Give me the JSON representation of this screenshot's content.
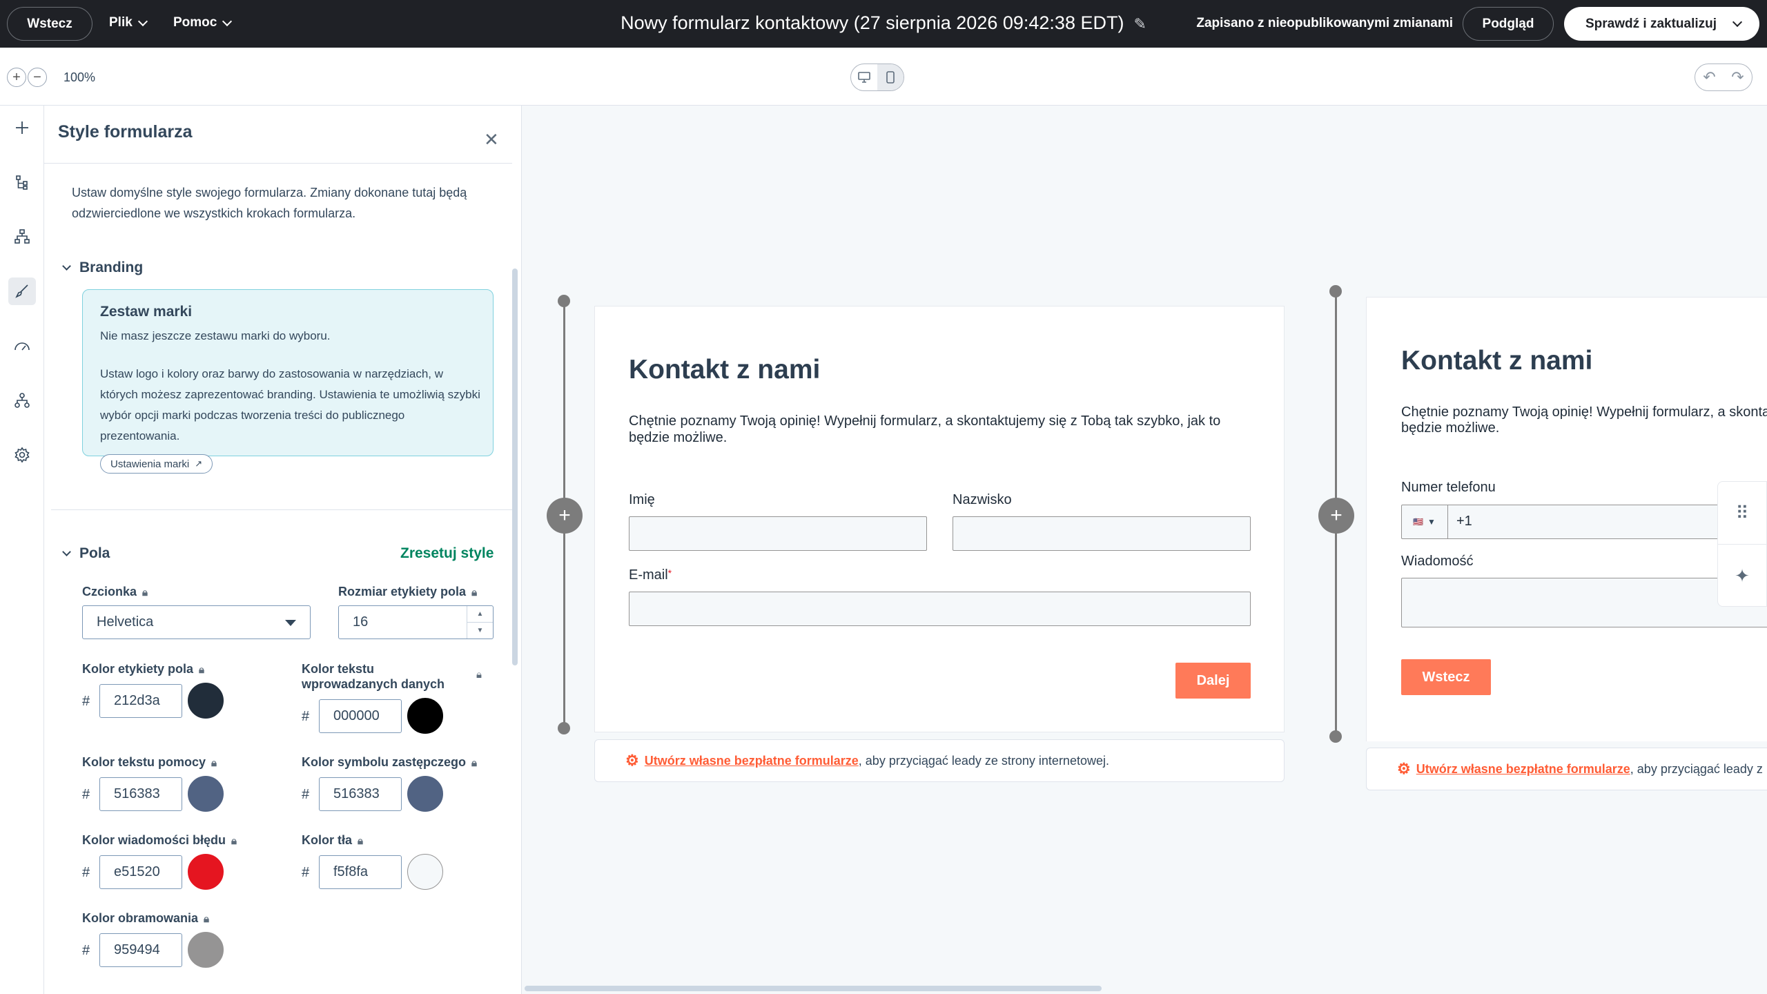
{
  "topbar": {
    "back_label": "Wstecz",
    "file_menu": "Plik",
    "help_menu": "Pomoc",
    "title": "Nowy formularz kontaktowy (27 sierpnia 2026 09:42:38 EDT)",
    "status": "Zapisano z nieopublikowanymi zmianami",
    "preview_label": "Podgląd",
    "publish_label": "Sprawdź i zaktualizuj"
  },
  "toolbar": {
    "zoom": "100%",
    "zoom_in": "+",
    "zoom_out": "−"
  },
  "rail": {
    "icons": [
      "add-icon",
      "tree-icon",
      "hierarchy-icon",
      "brush-icon",
      "gauge-icon",
      "org-chart-icon",
      "gear-icon"
    ]
  },
  "panel": {
    "title": "Style formularza",
    "description": "Ustaw domyślne style swojego formularza. Zmiany dokonane tutaj będą odzwierciedlone we wszystkich krokach formularza.",
    "branding": {
      "heading": "Branding",
      "box_title": "Zestaw marki",
      "box_text1": "Nie masz jeszcze zestawu marki do wyboru.",
      "box_text2": "Ustaw logo i kolory oraz barwy do zastosowania w narzędziach, w których możesz zaprezentować branding. Ustawienia te umożliwią szybki wybór opcji marki podczas tworzenia treści do publicznego prezentowania.",
      "link_label": "Ustawienia marki"
    },
    "fields": {
      "heading": "Pola",
      "reset_label": "Zresetuj style",
      "font_label": "Czcionka",
      "font_value": "Helvetica",
      "label_size_label": "Rozmiar etykiety pola",
      "label_size_value": "16",
      "label_color_label": "Kolor etykiety pola",
      "label_color_value": "212d3a",
      "input_text_color_label_line1": "Kolor tekstu",
      "input_text_color_label_line2": "wprowadzanych danych",
      "input_text_color_value": "000000",
      "help_text_color_label": "Kolor tekstu pomocy",
      "help_text_color_value": "516383",
      "placeholder_color_label": "Kolor symbolu zastępczego",
      "placeholder_color_value": "516383",
      "error_color_label": "Kolor wiadomości błędu",
      "error_color_value": "e51520",
      "background_color_label": "Kolor tła",
      "background_color_value": "f5f8fa",
      "border_color_label": "Kolor obramowania",
      "border_color_value": "959494",
      "hash": "#"
    }
  },
  "form_step1": {
    "title": "Kontakt z nami",
    "description": "Chętnie poznamy Twoją opinię! Wypełnij formularz, a skontaktujemy się z Tobą tak szybko, jak to będzie możliwe.",
    "first_name_label": "Imię",
    "last_name_label": "Nazwisko",
    "email_label": "E-mail",
    "required_mark": "*",
    "next_label": "Dalej"
  },
  "form_step2": {
    "title": "Kontakt z nami",
    "description_line1": "Chętnie poznamy Twoją opinię! Wypełnij formularz, a skonta",
    "description_line2": "będzie możliwe.",
    "phone_label": "Numer telefonu",
    "phone_prefix": "+1",
    "message_label": "Wiadomość",
    "back_label": "Wstecz"
  },
  "footer": {
    "link_text": "Utwórz własne bezpłatne formularze",
    "rest_text": ", aby przyciągać leady ze strony internetowej.",
    "rest_text_cut": ", aby przyciągać leady z"
  },
  "colors": {
    "topbar": "#1f2126",
    "accent": "#ff7a59",
    "link_green": "#00845f",
    "label_color": "#212d3a",
    "input_text_color": "#000000",
    "help_text_color": "#516383",
    "placeholder_color": "#516383",
    "error_color": "#e51520",
    "background_color": "#f5f8fa",
    "border_color": "#959494"
  }
}
